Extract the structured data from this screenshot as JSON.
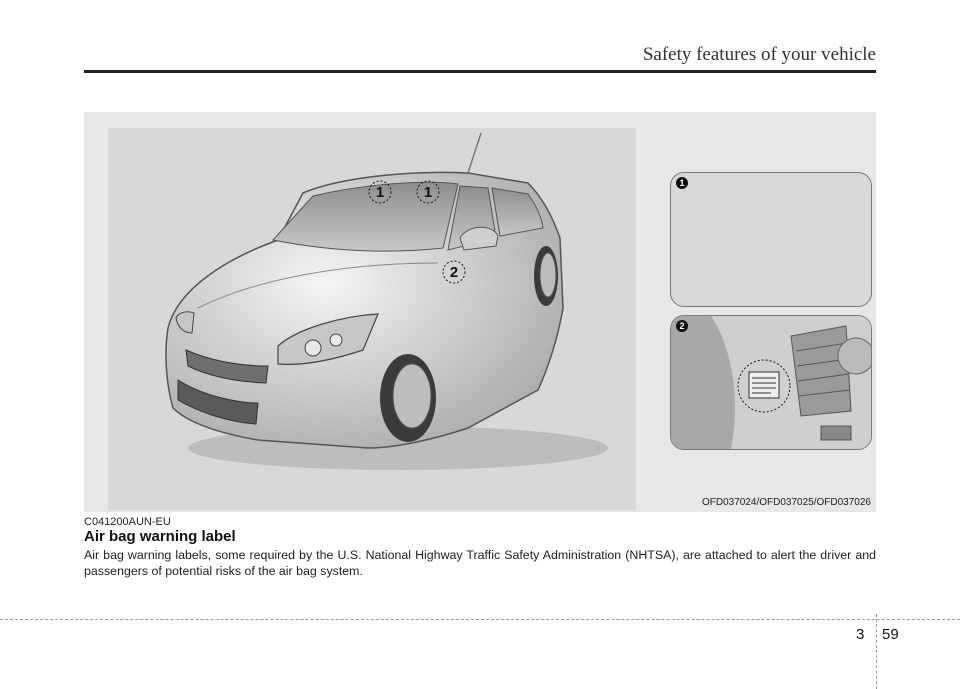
{
  "header": {
    "title": "Safety features of your vehicle"
  },
  "figure": {
    "callout_1": "1",
    "callout_2": "2",
    "inset_1_number": "1",
    "inset_2_number": "2",
    "caption": "OFD037024/OFD037025/OFD037026"
  },
  "section": {
    "code": "C041200AUN-EU",
    "title": "Air bag warning label",
    "body": "Air bag warning labels, some required by the U.S. National Highway Traffic Safety Administration (NHTSA), are attached to alert the driver and passengers of potential risks of the air bag system."
  },
  "footer": {
    "section_number": "3",
    "page_number": "59"
  }
}
